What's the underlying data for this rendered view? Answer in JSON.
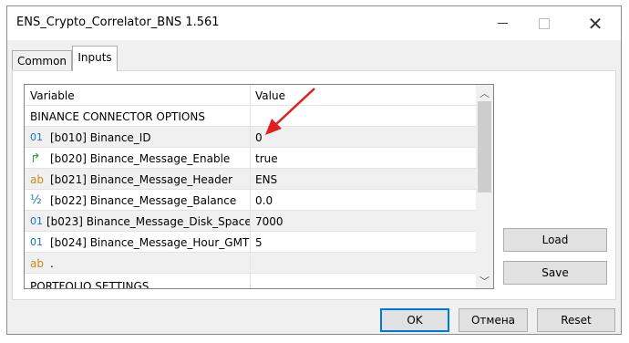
{
  "window": {
    "title": "ENS_Crypto_Correlator_BNS 1.561",
    "close_glyph": "✕"
  },
  "tabs": [
    {
      "label": "Common",
      "active": false
    },
    {
      "label": "Inputs",
      "active": true
    }
  ],
  "grid": {
    "headers": {
      "variable": "Variable",
      "value": "Value"
    },
    "section": "BINANCE CONNECTOR OPTIONS",
    "rows": [
      {
        "icon": "int-type-icon",
        "glyph": "01",
        "variable": "[b010] Binance_ID",
        "value": "0"
      },
      {
        "icon": "bool-type-icon",
        "glyph": "↱",
        "variable": "[b020] Binance_Message_Enable",
        "value": "true"
      },
      {
        "icon": "string-type-icon",
        "glyph": "ab",
        "variable": "[b021] Binance_Message_Header",
        "value": "ENS"
      },
      {
        "icon": "double-type-icon",
        "glyph": "½",
        "variable": "[b022] Binance_Message_Balance",
        "value": "0.0"
      },
      {
        "icon": "int-type-icon",
        "glyph": "01",
        "variable": "[b023] Binance_Message_Disk_Space...",
        "value": "7000"
      },
      {
        "icon": "int-type-icon",
        "glyph": "01",
        "variable": "[b024] Binance_Message_Hour_GMT",
        "value": "5"
      },
      {
        "icon": "string-type-icon",
        "glyph": "ab",
        "variable": ".",
        "value": ""
      }
    ],
    "next_section": "PORTFOLIO SETTINGS"
  },
  "side_buttons": {
    "load": "Load",
    "save": "Save"
  },
  "footer_buttons": {
    "ok": "OK",
    "cancel": "Отмена",
    "reset": "Reset"
  },
  "colors": {
    "annotation_arrow": "#e02020",
    "default_button_border": "#0078d7"
  }
}
